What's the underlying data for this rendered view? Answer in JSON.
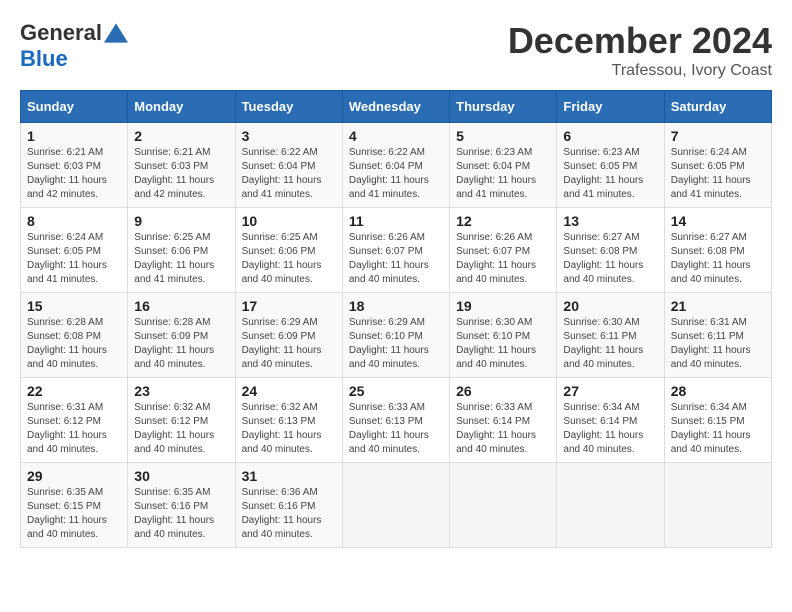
{
  "logo": {
    "general": "General",
    "blue": "Blue"
  },
  "title": {
    "month": "December 2024",
    "location": "Trafessou, Ivory Coast"
  },
  "weekdays": [
    "Sunday",
    "Monday",
    "Tuesday",
    "Wednesday",
    "Thursday",
    "Friday",
    "Saturday"
  ],
  "weeks": [
    [
      {
        "day": "1",
        "sunrise": "6:21 AM",
        "sunset": "6:03 PM",
        "daylight": "11 hours and 42 minutes."
      },
      {
        "day": "2",
        "sunrise": "6:21 AM",
        "sunset": "6:03 PM",
        "daylight": "11 hours and 42 minutes."
      },
      {
        "day": "3",
        "sunrise": "6:22 AM",
        "sunset": "6:04 PM",
        "daylight": "11 hours and 41 minutes."
      },
      {
        "day": "4",
        "sunrise": "6:22 AM",
        "sunset": "6:04 PM",
        "daylight": "11 hours and 41 minutes."
      },
      {
        "day": "5",
        "sunrise": "6:23 AM",
        "sunset": "6:04 PM",
        "daylight": "11 hours and 41 minutes."
      },
      {
        "day": "6",
        "sunrise": "6:23 AM",
        "sunset": "6:05 PM",
        "daylight": "11 hours and 41 minutes."
      },
      {
        "day": "7",
        "sunrise": "6:24 AM",
        "sunset": "6:05 PM",
        "daylight": "11 hours and 41 minutes."
      }
    ],
    [
      {
        "day": "8",
        "sunrise": "6:24 AM",
        "sunset": "6:05 PM",
        "daylight": "11 hours and 41 minutes."
      },
      {
        "day": "9",
        "sunrise": "6:25 AM",
        "sunset": "6:06 PM",
        "daylight": "11 hours and 41 minutes."
      },
      {
        "day": "10",
        "sunrise": "6:25 AM",
        "sunset": "6:06 PM",
        "daylight": "11 hours and 40 minutes."
      },
      {
        "day": "11",
        "sunrise": "6:26 AM",
        "sunset": "6:07 PM",
        "daylight": "11 hours and 40 minutes."
      },
      {
        "day": "12",
        "sunrise": "6:26 AM",
        "sunset": "6:07 PM",
        "daylight": "11 hours and 40 minutes."
      },
      {
        "day": "13",
        "sunrise": "6:27 AM",
        "sunset": "6:08 PM",
        "daylight": "11 hours and 40 minutes."
      },
      {
        "day": "14",
        "sunrise": "6:27 AM",
        "sunset": "6:08 PM",
        "daylight": "11 hours and 40 minutes."
      }
    ],
    [
      {
        "day": "15",
        "sunrise": "6:28 AM",
        "sunset": "6:08 PM",
        "daylight": "11 hours and 40 minutes."
      },
      {
        "day": "16",
        "sunrise": "6:28 AM",
        "sunset": "6:09 PM",
        "daylight": "11 hours and 40 minutes."
      },
      {
        "day": "17",
        "sunrise": "6:29 AM",
        "sunset": "6:09 PM",
        "daylight": "11 hours and 40 minutes."
      },
      {
        "day": "18",
        "sunrise": "6:29 AM",
        "sunset": "6:10 PM",
        "daylight": "11 hours and 40 minutes."
      },
      {
        "day": "19",
        "sunrise": "6:30 AM",
        "sunset": "6:10 PM",
        "daylight": "11 hours and 40 minutes."
      },
      {
        "day": "20",
        "sunrise": "6:30 AM",
        "sunset": "6:11 PM",
        "daylight": "11 hours and 40 minutes."
      },
      {
        "day": "21",
        "sunrise": "6:31 AM",
        "sunset": "6:11 PM",
        "daylight": "11 hours and 40 minutes."
      }
    ],
    [
      {
        "day": "22",
        "sunrise": "6:31 AM",
        "sunset": "6:12 PM",
        "daylight": "11 hours and 40 minutes."
      },
      {
        "day": "23",
        "sunrise": "6:32 AM",
        "sunset": "6:12 PM",
        "daylight": "11 hours and 40 minutes."
      },
      {
        "day": "24",
        "sunrise": "6:32 AM",
        "sunset": "6:13 PM",
        "daylight": "11 hours and 40 minutes."
      },
      {
        "day": "25",
        "sunrise": "6:33 AM",
        "sunset": "6:13 PM",
        "daylight": "11 hours and 40 minutes."
      },
      {
        "day": "26",
        "sunrise": "6:33 AM",
        "sunset": "6:14 PM",
        "daylight": "11 hours and 40 minutes."
      },
      {
        "day": "27",
        "sunrise": "6:34 AM",
        "sunset": "6:14 PM",
        "daylight": "11 hours and 40 minutes."
      },
      {
        "day": "28",
        "sunrise": "6:34 AM",
        "sunset": "6:15 PM",
        "daylight": "11 hours and 40 minutes."
      }
    ],
    [
      {
        "day": "29",
        "sunrise": "6:35 AM",
        "sunset": "6:15 PM",
        "daylight": "11 hours and 40 minutes."
      },
      {
        "day": "30",
        "sunrise": "6:35 AM",
        "sunset": "6:16 PM",
        "daylight": "11 hours and 40 minutes."
      },
      {
        "day": "31",
        "sunrise": "6:36 AM",
        "sunset": "6:16 PM",
        "daylight": "11 hours and 40 minutes."
      },
      null,
      null,
      null,
      null
    ]
  ],
  "labels": {
    "sunrise": "Sunrise:",
    "sunset": "Sunset:",
    "daylight": "Daylight:"
  }
}
